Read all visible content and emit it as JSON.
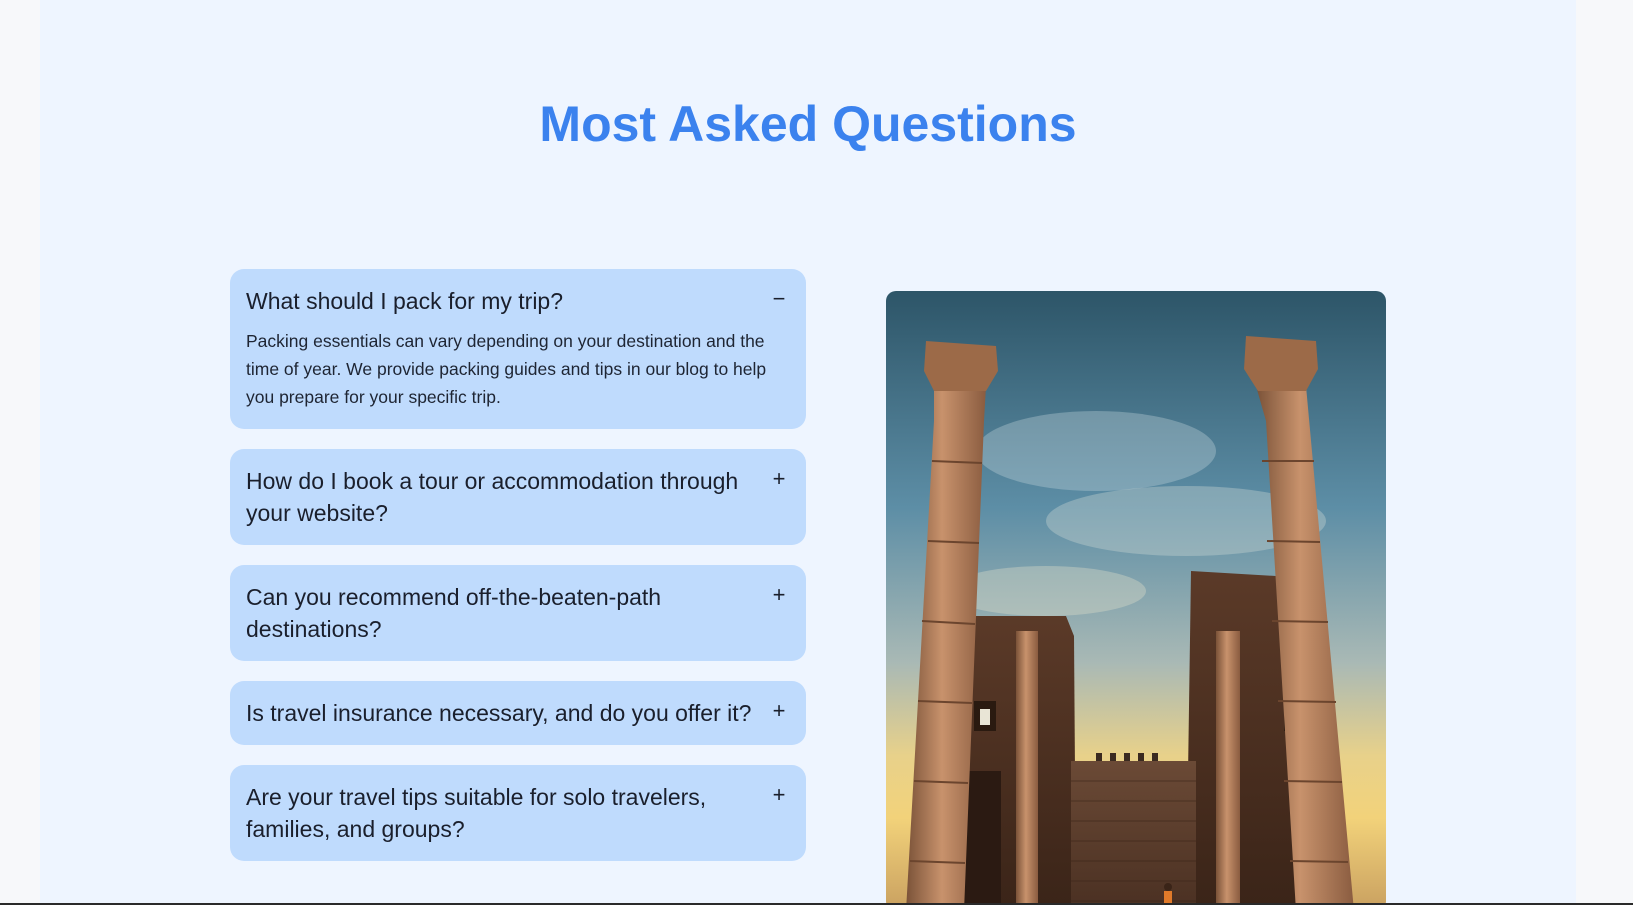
{
  "page": {
    "heading": "Most Asked Questions"
  },
  "faq": {
    "items": [
      {
        "question": "What should I pack for my trip?",
        "toggle": "−",
        "answer": "Packing essentials can vary depending on your destination and the time of year. We provide packing guides and tips in our blog to help you prepare for your specific trip."
      },
      {
        "question": "How do I book a tour or accommodation through your website?",
        "toggle": "+"
      },
      {
        "question": "Can you recommend off-the-beaten-path destinations?",
        "toggle": "+"
      },
      {
        "question": "Is travel insurance necessary, and do you offer it?",
        "toggle": "+"
      },
      {
        "question": "Are your travel tips suitable for solo travelers, families, and groups?",
        "toggle": "+"
      }
    ]
  },
  "colors": {
    "accent": "#3b82ee",
    "panel_background": "#eef5ff",
    "faq_card": "#bfdbfd"
  }
}
